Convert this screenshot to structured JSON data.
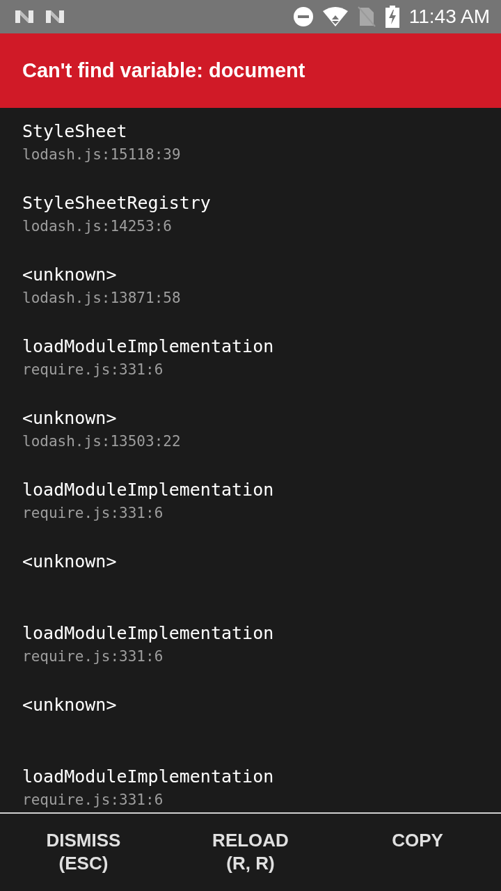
{
  "status_bar": {
    "time": "11:43 AM"
  },
  "header": {
    "title": "Can't find variable: document"
  },
  "stack": [
    {
      "method": "StyleSheet",
      "location": "lodash.js:15118:39"
    },
    {
      "method": "StyleSheetRegistry",
      "location": "lodash.js:14253:6"
    },
    {
      "method": "<unknown>",
      "location": "lodash.js:13871:58"
    },
    {
      "method": "loadModuleImplementation",
      "location": "require.js:331:6"
    },
    {
      "method": "<unknown>",
      "location": "lodash.js:13503:22"
    },
    {
      "method": "loadModuleImplementation",
      "location": "require.js:331:6"
    },
    {
      "method": "<unknown>"
    },
    {
      "method": "loadModuleImplementation",
      "location": "require.js:331:6"
    },
    {
      "method": "<unknown>"
    },
    {
      "method": "loadModuleImplementation",
      "location": "require.js:331:6"
    }
  ],
  "buttons": [
    {
      "label": "DISMISS\n(ESC)"
    },
    {
      "label": "RELOAD\n(R, R)"
    },
    {
      "label": "COPY"
    }
  ]
}
